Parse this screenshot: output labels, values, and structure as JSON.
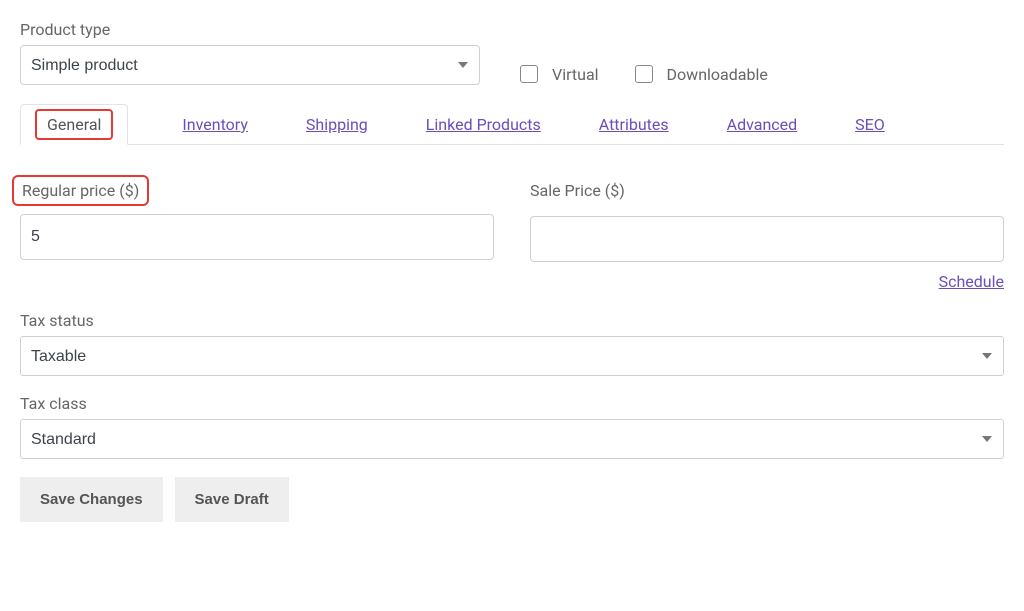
{
  "labels": {
    "product_type": "Product type",
    "virtual": "Virtual",
    "downloadable": "Downloadable",
    "regular_price": "Regular price ($)",
    "sale_price": "Sale Price ($)",
    "schedule": "Schedule",
    "tax_status": "Tax status",
    "tax_class": "Tax class"
  },
  "product_type": {
    "selected": "Simple product"
  },
  "tabs": {
    "general": "General",
    "inventory": "Inventory",
    "shipping": "Shipping",
    "linked_products": "Linked Products",
    "attributes": "Attributes",
    "advanced": "Advanced",
    "seo": "SEO"
  },
  "prices": {
    "regular": "5",
    "sale": ""
  },
  "tax": {
    "status": "Taxable",
    "class": "Standard"
  },
  "buttons": {
    "save_changes": "Save Changes",
    "save_draft": "Save Draft"
  }
}
